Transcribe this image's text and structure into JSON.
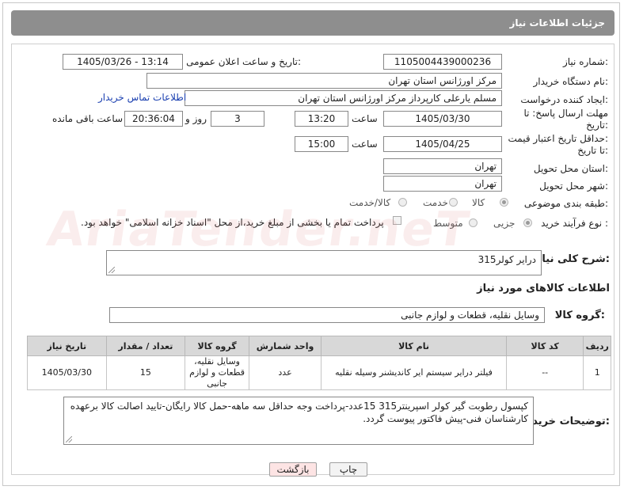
{
  "page": {
    "title": "جزئیات اطلاعات نیاز"
  },
  "form": {
    "need_number_label": "شماره نیاز:",
    "need_number": "1105004439000236",
    "announce_label": "تاریخ و ساعت اعلان عمومی:",
    "announce_value": "1405/03/26 - 13:14",
    "buyer_org_label": "نام دستگاه خریدار:",
    "buyer_org": "مرکز اورژانس استان تهران",
    "requester_label": "ایجاد کننده درخواست:",
    "requester": "مسلم یارعلی کارپرداز مرکز اورژانس استان تهران",
    "contact_link": "اطلاعات تماس خریدار",
    "deadline_label_1": "مهلت ارسال پاسخ: تا",
    "deadline_label_2": "تاریخ:",
    "deadline_date": "1405/03/30",
    "time_label": "ساعت",
    "deadline_time": "13:20",
    "days_value": "3",
    "days_label": "روز و",
    "remaining_time": "20:36:04",
    "remaining_label": "ساعت باقی مانده",
    "validity_label_1": "حداقل تاریخ اعتبار قیمت:",
    "validity_label_2": "تا تاریخ:",
    "validity_date": "1405/04/25",
    "validity_time": "15:00",
    "province_label": "استان محل تحویل:",
    "province": "تهران",
    "city_label": "شهر محل تحویل:",
    "city": "تهران",
    "category_label": "طبقه بندی موضوعی:",
    "category_options": [
      "کالا",
      "خدمت",
      "کالا/خدمت"
    ],
    "category_selected": "کالا",
    "process_label": "نوع فرآیند خرید :",
    "process_options": [
      "جزیی",
      "متوسط"
    ],
    "process_note": "پرداخت تمام یا بخشی از مبلغ خرید،از محل \"اسناد خزانه اسلامی\" خواهد بود.",
    "description_label": "شرح کلی نیاز:",
    "description": "درایر کولر315",
    "goods_info_title": "اطلاعات کالاهای مورد نیاز",
    "goods_group_label": "گروه کالا:",
    "goods_group": "وسایل نقلیه، قطعات و لوازم جانبی"
  },
  "table": {
    "headers": [
      "ردیف",
      "کد کالا",
      "نام کالا",
      "واحد شمارش",
      "گروه کالا",
      "تعداد / مقدار",
      "تاریخ نیاز"
    ],
    "rows": [
      [
        "1",
        "--",
        "فیلتر درایر سیستم ایر کاندیشنر وسیله نقلیه",
        "عدد",
        "وسایل نقلیه، قطعات و لوازم جانبی",
        "15",
        "1405/03/30"
      ]
    ]
  },
  "notes": {
    "label": "توضیحات خریدار:",
    "text": "کپسول رطوبت گیر کولر اسپرینتر315     15عدد-پرداخت وجه حداقل سه ماهه-حمل کالا رایگان-تایید اصالت کالا برعهده کارشناسان فنی-پیش فاکتور پیوست گردد."
  },
  "buttons": {
    "print": "چاپ",
    "back": "بازگشت"
  },
  "colors": {
    "titlebar": "#8e8e8e",
    "back_button": "#fde4e4",
    "link": "#1a3fb0"
  }
}
